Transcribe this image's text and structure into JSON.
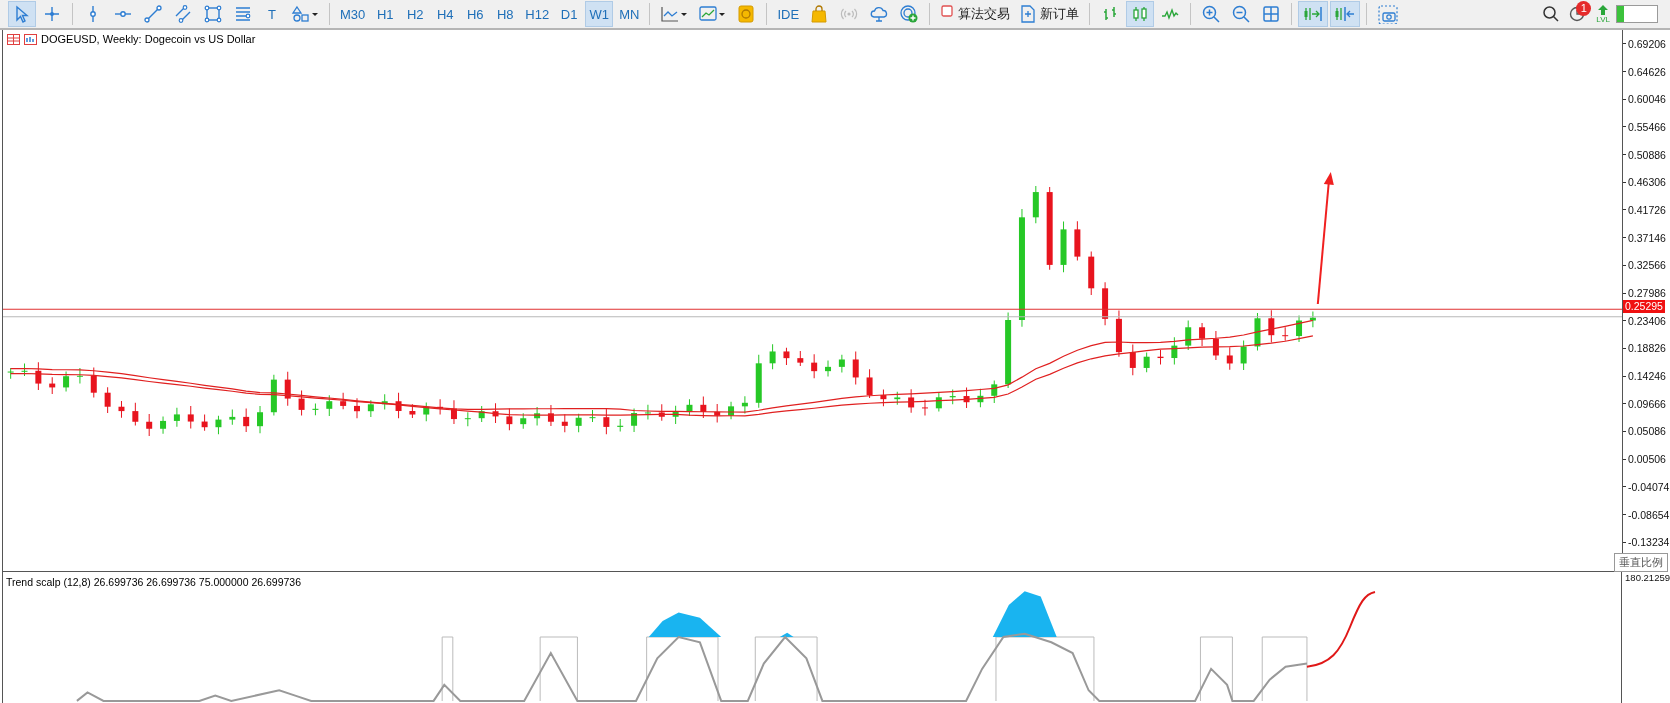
{
  "toolbar": {
    "groups": [
      [
        {
          "kind": "cursor",
          "selected": true
        },
        {
          "kind": "crosshair",
          "selected": false
        }
      ],
      [
        {
          "kind": "vline",
          "selected": false
        },
        {
          "kind": "hline",
          "selected": false
        },
        {
          "kind": "trend",
          "selected": false
        },
        {
          "kind": "channel",
          "selected": false
        },
        {
          "kind": "rect",
          "selected": false
        },
        {
          "kind": "fibo",
          "selected": false
        },
        {
          "kind": "text",
          "label": "T",
          "selected": false
        },
        {
          "kind": "shapes",
          "selected": false
        }
      ],
      [
        {
          "kind": "timeframe",
          "label": "M30",
          "selected": false
        },
        {
          "kind": "timeframe",
          "label": "H1",
          "selected": false
        },
        {
          "kind": "timeframe",
          "label": "H2",
          "selected": false
        },
        {
          "kind": "timeframe",
          "label": "H4",
          "selected": false
        },
        {
          "kind": "timeframe",
          "label": "H6",
          "selected": false
        },
        {
          "kind": "timeframe",
          "label": "H8",
          "selected": false
        },
        {
          "kind": "timeframe",
          "label": "H12",
          "selected": false
        },
        {
          "kind": "timeframe",
          "label": "D1",
          "selected": false
        },
        {
          "kind": "timeframe",
          "label": "W1",
          "selected": true
        },
        {
          "kind": "timeframe",
          "label": "MN",
          "selected": false
        }
      ],
      [
        {
          "kind": "chartstyle",
          "selected": false
        },
        {
          "kind": "template",
          "selected": false
        },
        {
          "kind": "coin",
          "selected": false
        }
      ],
      [
        {
          "kind": "text",
          "label": "IDE",
          "selected": false
        },
        {
          "kind": "bag",
          "selected": false
        },
        {
          "kind": "signal",
          "selected": false
        },
        {
          "kind": "cloud",
          "selected": false
        },
        {
          "kind": "addcloud",
          "selected": false
        }
      ],
      [
        {
          "kind": "algo",
          "label": "算法交易",
          "selected": false
        },
        {
          "kind": "order",
          "label": "新订单",
          "selected": false
        }
      ],
      [
        {
          "kind": "bars",
          "selected": false
        },
        {
          "kind": "candles",
          "selected": true
        },
        {
          "kind": "line",
          "selected": false
        }
      ],
      [
        {
          "kind": "zoomin",
          "selected": false
        },
        {
          "kind": "zoomout",
          "selected": false
        },
        {
          "kind": "tile",
          "selected": false
        }
      ],
      [
        {
          "kind": "autoscroll",
          "selected": true
        },
        {
          "kind": "shift",
          "selected": true
        }
      ],
      [
        {
          "kind": "screenshot",
          "selected": false
        }
      ]
    ],
    "notifications": {
      "badge": "1"
    },
    "level_icon": {
      "label": "LVL"
    },
    "level_meter": {
      "level": 0.18
    }
  },
  "chart": {
    "title": "DOGEUSD, Weekly:  Dogecoin vs US Dollar",
    "price_ticks": [
      "0.69206",
      "0.64626",
      "0.60046",
      "0.55466",
      "0.50886",
      "0.46306",
      "0.41726",
      "0.37146",
      "0.32566",
      "0.27986",
      "0.23406",
      "0.18826",
      "0.14246",
      "0.09666",
      "0.05086",
      "0.00506",
      "-0.04074",
      "-0.08654",
      "-0.13234"
    ],
    "current_price": "0.25295",
    "scale_button": "垂直比例"
  },
  "indicator": {
    "title": "Trend scalp (12,8) 26.699736 26.699736 75.000000 26.699736",
    "scale_label": "180.21259"
  }
}
